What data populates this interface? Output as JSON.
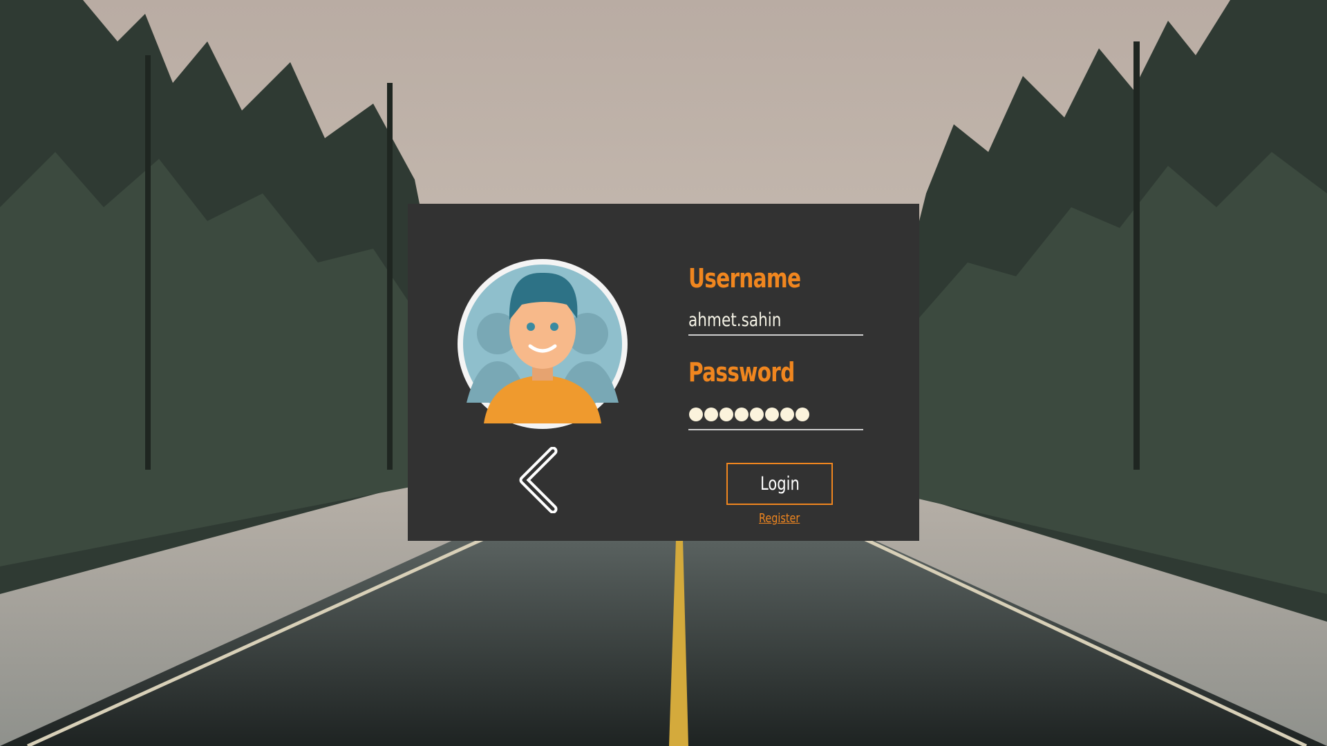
{
  "login": {
    "username_label": "Username",
    "username_value": "ahmet.sahin",
    "password_label": "Password",
    "password_masked_length": 8,
    "login_label": "Login",
    "register_label": "Register"
  },
  "icons": {
    "avatar": "user-avatar-icon",
    "back": "chevron-left-icon"
  },
  "colors": {
    "accent": "#f0861f",
    "panel": "#323232",
    "text": "#f5f3e6",
    "dots": "#fbf3dc"
  }
}
